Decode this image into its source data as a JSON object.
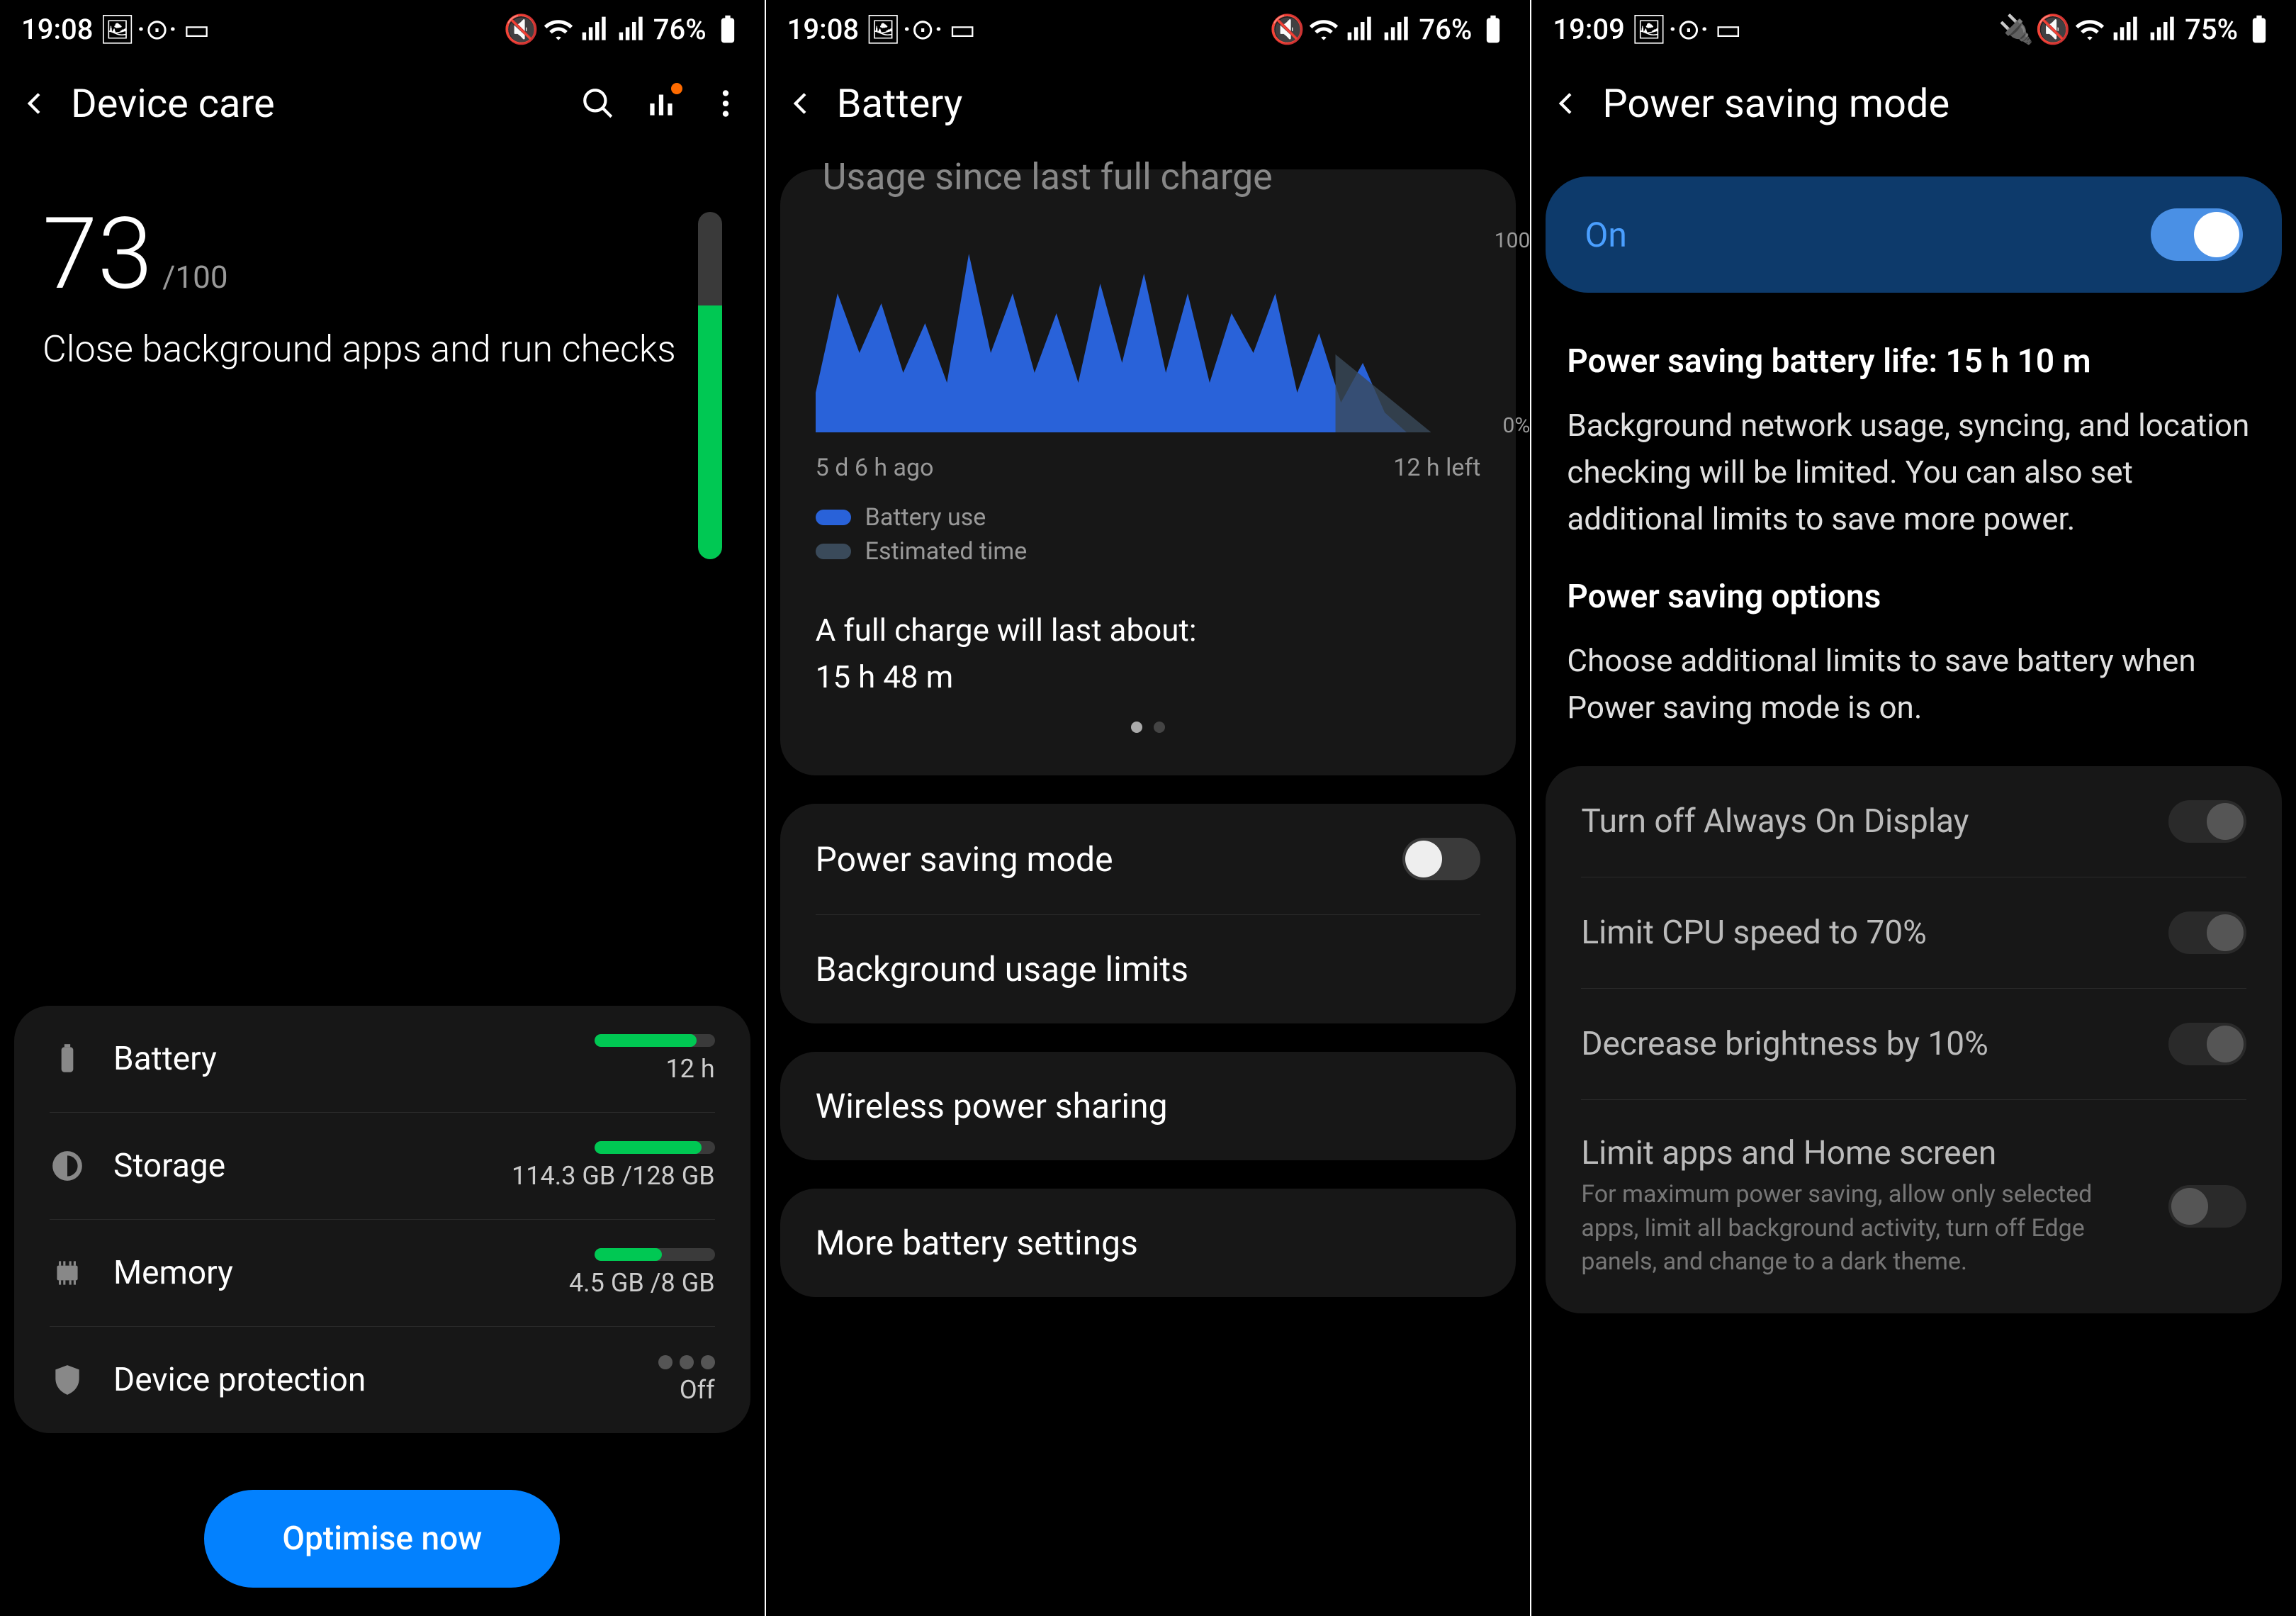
{
  "screen1": {
    "status": {
      "time": "19:08",
      "battery": "76%"
    },
    "header": {
      "title": "Device care"
    },
    "score": {
      "value": "73",
      "max": "/100",
      "message": "Close background apps and run checks"
    },
    "items": {
      "battery": {
        "label": "Battery",
        "value": "12 h",
        "pct": 85
      },
      "storage": {
        "label": "Storage",
        "value": "114.3 GB /128 GB",
        "pct": 89
      },
      "memory": {
        "label": "Memory",
        "value": "4.5 GB /8 GB",
        "pct": 56
      },
      "protection": {
        "label": "Device protection",
        "value": "Off"
      }
    },
    "optimise": "Optimise now"
  },
  "screen2": {
    "status": {
      "time": "19:08",
      "battery": "76%"
    },
    "header": {
      "title": "Battery"
    },
    "chart_title": "Usage since last full charge",
    "axis_left": "5 d 6 h ago",
    "axis_right": "12 h left",
    "legend": {
      "use": "Battery use",
      "est": "Estimated time"
    },
    "full_label": "A full charge will last about:",
    "full_value": "15 h 48 m",
    "rows": {
      "psm": "Power saving mode",
      "bgl": "Background usage limits",
      "wps": "Wireless power sharing",
      "more": "More battery settings"
    }
  },
  "screen3": {
    "status": {
      "time": "19:09",
      "battery": "75%"
    },
    "header": {
      "title": "Power saving mode"
    },
    "on_label": "On",
    "life_label": "Power saving battery life: 15 h 10 m",
    "desc": "Background network usage, syncing, and location checking will be limited. You can also set additional limits to save more power.",
    "opts_heading": "Power saving options",
    "opts_desc": "Choose additional limits to save battery when Power saving mode is on.",
    "opts": {
      "aod": "Turn off Always On Display",
      "cpu": "Limit CPU speed to 70%",
      "bright": "Decrease brightness by 10%",
      "limit": "Limit apps and Home screen",
      "limit_sub": "For maximum power saving, allow only selected apps, limit all background activity, turn off Edge panels, and change to a dark theme."
    }
  },
  "chart_data": {
    "type": "area",
    "title": "Usage since last full charge",
    "xlabel": "",
    "ylabel": "%",
    "ylim": [
      0,
      100
    ],
    "x_range_label_start": "5 d 6 h ago",
    "x_range_label_end": "12 h left",
    "series": [
      {
        "name": "Battery use",
        "values": [
          20,
          70,
          40,
          65,
          30,
          55,
          25,
          90,
          40,
          70,
          30,
          60,
          25,
          75,
          35,
          80,
          30,
          70,
          25,
          60,
          40,
          70,
          20,
          50,
          15,
          35,
          10,
          0
        ]
      },
      {
        "name": "Estimated time",
        "values": [
          0,
          0,
          0,
          0,
          0,
          0,
          0,
          0,
          0,
          0,
          0,
          0,
          0,
          0,
          0,
          0,
          0,
          0,
          0,
          0,
          0,
          0,
          0,
          0,
          0,
          0,
          0,
          0
        ]
      }
    ]
  }
}
